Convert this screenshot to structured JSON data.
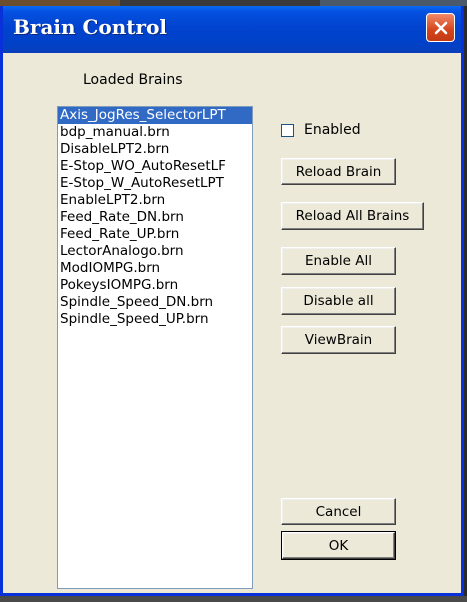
{
  "window": {
    "title": "Brain Control"
  },
  "list": {
    "label": "Loaded Brains",
    "items": [
      "Axis_JogRes_SelectorLPT",
      "bdp_manual.brn",
      "DisableLPT2.brn",
      "E-Stop_WO_AutoResetLF",
      "E-Stop_W_AutoResetLPT",
      "EnableLPT2.brn",
      "Feed_Rate_DN.brn",
      "Feed_Rate_UP.brn",
      "LectorAnalogo.brn",
      "ModIOMPG.brn",
      "PokeysIOMPG.brn",
      "Spindle_Speed_DN.brn",
      "Spindle_Speed_UP.brn"
    ],
    "selected_index": 0
  },
  "controls": {
    "enabled_label": "Enabled",
    "enabled_checked": false,
    "reload_brain": "Reload Brain",
    "reload_all": "Reload All Brains",
    "enable_all": "Enable All",
    "disable_all": "Disable all",
    "view_brain": "ViewBrain",
    "cancel": "Cancel",
    "ok": "OK"
  },
  "icons": {
    "close": "close-icon"
  },
  "colors": {
    "titlebar": "#0143cf",
    "selection": "#316ac5",
    "close": "#d4441c"
  }
}
